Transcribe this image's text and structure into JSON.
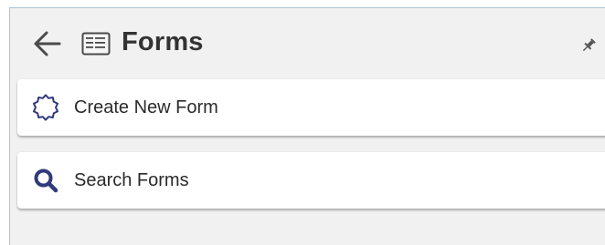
{
  "header": {
    "title": "Forms",
    "back_icon": "arrow-left-icon",
    "app_icon": "forms-list-icon",
    "pin_icon": "pin-icon"
  },
  "menu": {
    "items": [
      {
        "label": "Create New Form",
        "icon": "badge-outline-icon"
      },
      {
        "label": "Search Forms",
        "icon": "search-icon"
      }
    ]
  },
  "colors": {
    "panel_background": "#f1f1f1",
    "card_background": "#ffffff",
    "icon_accent": "#2f3a7c",
    "text": "#2b2b2b"
  }
}
